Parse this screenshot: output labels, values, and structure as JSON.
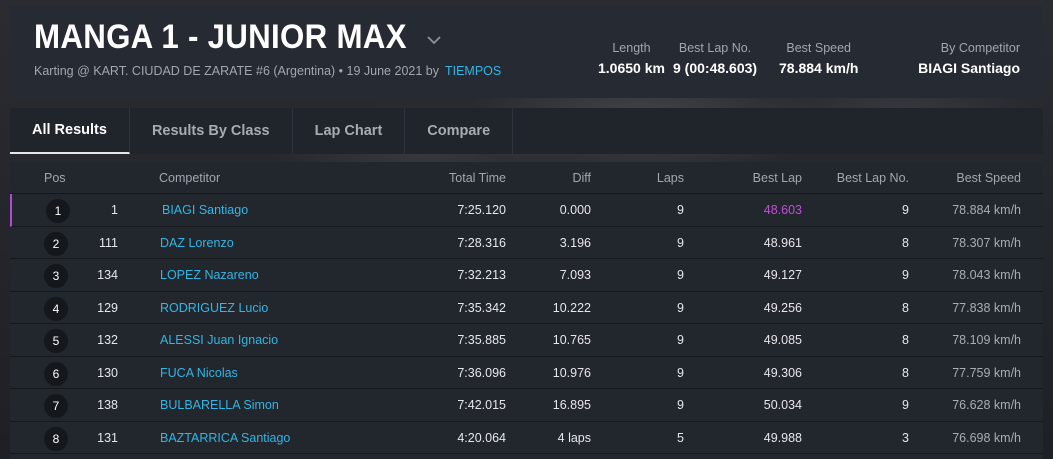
{
  "header": {
    "title": "MANGA 1 - JUNIOR MAX",
    "subtitle": "Karting @ KART. CIUDAD DE ZARATE #6 (Argentina) • 19 June 2021 by",
    "by_link": "TIEMPOS",
    "stats": [
      {
        "label": "Length",
        "value": "1.0650 km"
      },
      {
        "label": "Best Lap No.",
        "value": "9 (00:48.603)"
      },
      {
        "label": "Best Speed",
        "value": "78.884 km/h"
      },
      {
        "label": "By Competitor",
        "value": "BIAGI Santiago"
      }
    ]
  },
  "tabs": [
    {
      "label": "All Results"
    },
    {
      "label": "Results By Class"
    },
    {
      "label": "Lap Chart"
    },
    {
      "label": "Compare"
    }
  ],
  "table": {
    "columns": {
      "pos": "Pos",
      "competitor": "Competitor",
      "total_time": "Total Time",
      "diff": "Diff",
      "laps": "Laps",
      "best_lap": "Best Lap",
      "best_lap_no": "Best Lap No.",
      "best_speed": "Best Speed"
    },
    "rows": [
      {
        "pos": "1",
        "num": "1",
        "competitor": "BIAGI Santiago",
        "total_time": "7:25.120",
        "diff": "0.000",
        "laps": "9",
        "best_lap": "48.603",
        "best_lap_no": "9",
        "best_speed": "78.884 km/h"
      },
      {
        "pos": "2",
        "num": "111",
        "competitor": "DAZ Lorenzo",
        "total_time": "7:28.316",
        "diff": "3.196",
        "laps": "9",
        "best_lap": "48.961",
        "best_lap_no": "8",
        "best_speed": "78.307 km/h"
      },
      {
        "pos": "3",
        "num": "134",
        "competitor": "LOPEZ Nazareno",
        "total_time": "7:32.213",
        "diff": "7.093",
        "laps": "9",
        "best_lap": "49.127",
        "best_lap_no": "9",
        "best_speed": "78.043 km/h"
      },
      {
        "pos": "4",
        "num": "129",
        "competitor": "RODRIGUEZ Lucio",
        "total_time": "7:35.342",
        "diff": "10.222",
        "laps": "9",
        "best_lap": "49.256",
        "best_lap_no": "8",
        "best_speed": "77.838 km/h"
      },
      {
        "pos": "5",
        "num": "132",
        "competitor": "ALESSI Juan Ignacio",
        "total_time": "7:35.885",
        "diff": "10.765",
        "laps": "9",
        "best_lap": "49.085",
        "best_lap_no": "8",
        "best_speed": "78.109 km/h"
      },
      {
        "pos": "6",
        "num": "130",
        "competitor": "FUCA Nicolas",
        "total_time": "7:36.096",
        "diff": "10.976",
        "laps": "9",
        "best_lap": "49.306",
        "best_lap_no": "8",
        "best_speed": "77.759 km/h"
      },
      {
        "pos": "7",
        "num": "138",
        "competitor": "BULBARELLA Simon",
        "total_time": "7:42.015",
        "diff": "16.895",
        "laps": "9",
        "best_lap": "50.034",
        "best_lap_no": "9",
        "best_speed": "76.628 km/h"
      },
      {
        "pos": "8",
        "num": "131",
        "competitor": "BAZTARRICA Santiago",
        "total_time": "4:20.064",
        "diff": "4 laps",
        "laps": "5",
        "best_lap": "49.988",
        "best_lap_no": "3",
        "best_speed": "76.698 km/h"
      }
    ]
  },
  "colors": {
    "accent": "#33b5e5",
    "best_lap_highlight": "#c34fdc"
  }
}
